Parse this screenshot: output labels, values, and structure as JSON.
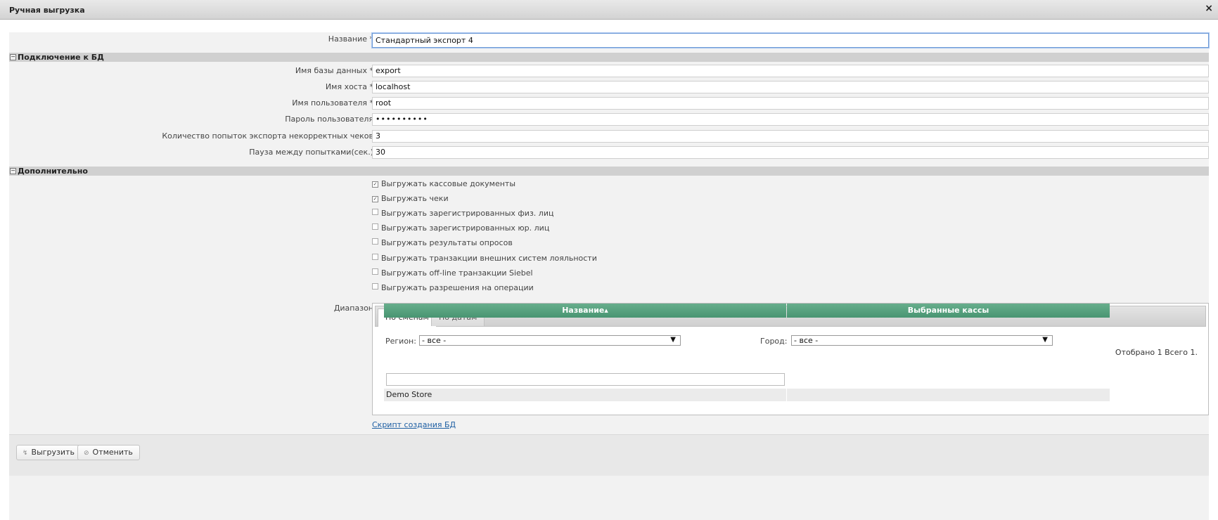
{
  "window": {
    "title": "Ручная выгрузка",
    "close_glyph": "×"
  },
  "form": {
    "name": {
      "label": "Название *",
      "value": "Стандартный экспорт 4"
    }
  },
  "db_section": {
    "title": "Подключение к БД",
    "toggle": "−",
    "fields": [
      {
        "label": "Имя базы данных *",
        "value": "export"
      },
      {
        "label": "Имя хоста *",
        "value": "localhost"
      },
      {
        "label": "Имя пользователя *",
        "value": "root"
      },
      {
        "label": "Пароль пользователя",
        "value": "••••••••••"
      },
      {
        "label": "Количество попыток экспорта некорректных чеков",
        "value": "3"
      },
      {
        "label": "Пауза между попытками(сек.)",
        "value": "30"
      }
    ]
  },
  "extra_section": {
    "title": "Дополнительно",
    "toggle": "−",
    "checkboxes": [
      {
        "label": "Выгружать кассовые документы",
        "checked": true,
        "mark": "✓"
      },
      {
        "label": "Выгружать чеки",
        "checked": true,
        "mark": "✓"
      },
      {
        "label": "Выгружать зарегистрированных физ. лиц",
        "checked": false,
        "mark": ""
      },
      {
        "label": "Выгружать зарегистрированных юр. лиц",
        "checked": false,
        "mark": ""
      },
      {
        "label": "Выгружать результаты опросов",
        "checked": false,
        "mark": ""
      },
      {
        "label": "Выгружать транзакции внешних систем лояльности",
        "checked": false,
        "mark": ""
      },
      {
        "label": "Выгружать off-line транзакции Siebel",
        "checked": false,
        "mark": ""
      },
      {
        "label": "Выгружать разрешения на операции",
        "checked": false,
        "mark": ""
      }
    ]
  },
  "range": {
    "label": "Диапазон",
    "tabs": [
      {
        "label": "По сменам",
        "active": true
      },
      {
        "label": "По датам",
        "active": false
      }
    ],
    "region": {
      "label": "Регион:",
      "value": "- все -",
      "arrow": "▼"
    },
    "city": {
      "label": "Город:",
      "value": "- все -",
      "arrow": "▼"
    },
    "counter": "Отобрано 1 Всего 1.",
    "grid": {
      "columns": [
        "Название",
        "Выбранные кассы"
      ],
      "sort_glyph": "▲",
      "rows": [
        {
          "name": "Demo Store",
          "selected": ""
        }
      ]
    }
  },
  "link": "Скрипт создания БД",
  "buttons": {
    "export": {
      "label": "Выгрузить",
      "icon": "↯"
    },
    "cancel": {
      "label": "Отменить",
      "icon": "⊘"
    }
  },
  "colors": {
    "grid_header": "#55a180",
    "section_bar": "#d0d0d0",
    "panel": "#f2f2f2",
    "link": "#1e5fa3"
  }
}
